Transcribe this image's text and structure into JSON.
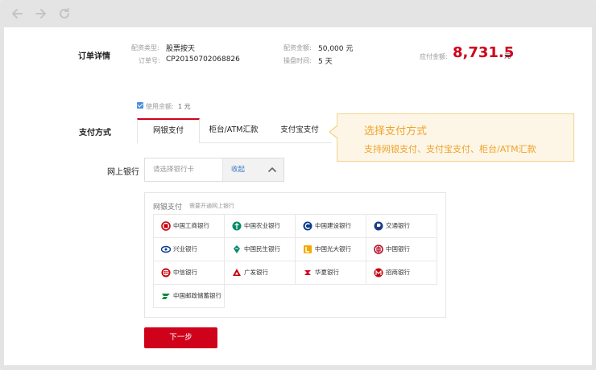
{
  "order": {
    "section_label": "订单详情",
    "type_label": "配资类型:",
    "type_value": "股票按天",
    "order_no_label": "订单号:",
    "order_no_value": "CP20150702068826",
    "amount_label": "配资金额:",
    "amount_value": "50,000 元",
    "days_label": "操盘时间:",
    "days_value": "5 天",
    "payable_label": "应付金额:",
    "payable_value": "8,731.5",
    "payable_unit": "元"
  },
  "balance": {
    "label": "使用余额:",
    "value": "1 元",
    "checked": true
  },
  "payment": {
    "section_label": "支付方式",
    "tabs": [
      {
        "label": "网银支付",
        "active": true
      },
      {
        "label": "柜台/ATM汇款",
        "active": false
      },
      {
        "label": "支付宝支付",
        "active": false
      }
    ]
  },
  "callout": {
    "title": "选择支付方式",
    "description": "支持网银支付、支付宝支付、柜台/ATM汇款"
  },
  "online_bank": {
    "label": "网上银行",
    "placeholder": "请选择银行卡",
    "collapse_label": "收起"
  },
  "bank_panel": {
    "title": "网银支付",
    "subtitle": "需要开通网上银行",
    "banks": [
      {
        "name": "中国工商银行",
        "icon": "icbc-logo-icon",
        "color": "#c7000b"
      },
      {
        "name": "中国农业银行",
        "icon": "abc-logo-icon",
        "color": "#008c69"
      },
      {
        "name": "中国建设银行",
        "icon": "ccb-logo-icon",
        "color": "#0a3b8c"
      },
      {
        "name": "交通银行",
        "icon": "bocom-logo-icon",
        "color": "#1d3b87"
      },
      {
        "name": "兴业银行",
        "icon": "cib-logo-icon",
        "color": "#0a3b8c"
      },
      {
        "name": "中国民生银行",
        "icon": "cmbc-logo-icon",
        "color": "#00846d"
      },
      {
        "name": "中国光大银行",
        "icon": "ceb-logo-icon",
        "color": "#f2a900"
      },
      {
        "name": "中国银行",
        "icon": "boc-logo-icon",
        "color": "#b5122b"
      },
      {
        "name": "中信银行",
        "icon": "citic-logo-icon",
        "color": "#c7000b"
      },
      {
        "name": "广发银行",
        "icon": "cgb-logo-icon",
        "color": "#c7000b"
      },
      {
        "name": "华夏银行",
        "icon": "hxb-logo-icon",
        "color": "#d0021b"
      },
      {
        "name": "招商银行",
        "icon": "cmb-logo-icon",
        "color": "#c7000b"
      },
      {
        "name": "中国邮政储蓄银行",
        "icon": "psbc-logo-icon",
        "color": "#008c3a"
      }
    ]
  },
  "next_button": "下一步",
  "colors": {
    "accent": "#d0021b",
    "callout_text": "#f0a22c",
    "link": "#3b78c6"
  }
}
